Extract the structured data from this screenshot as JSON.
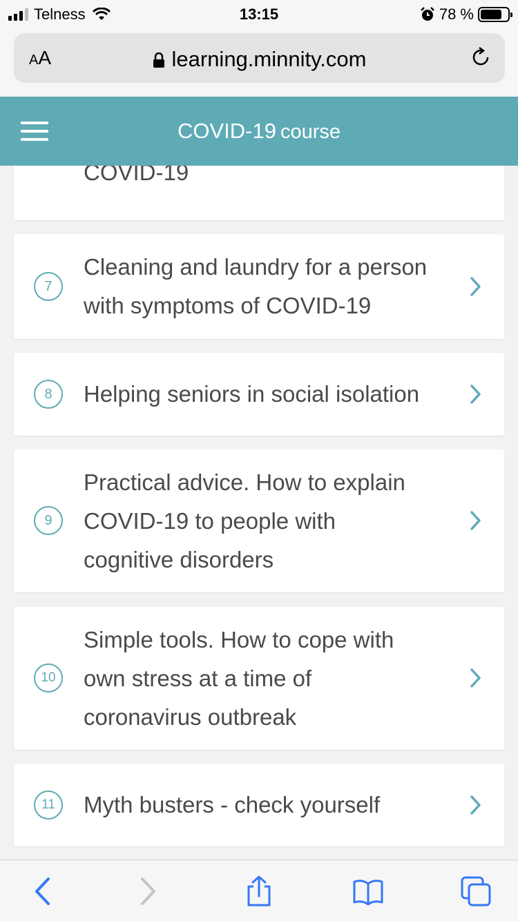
{
  "status_bar": {
    "carrier": "Telness",
    "time": "13:15",
    "battery": "78 %",
    "battery_level": 0.78
  },
  "browser": {
    "text_size_label_small": "A",
    "text_size_label_large": "A",
    "url": "learning.minnity.com"
  },
  "header": {
    "title_main": "COVID-19",
    "title_sub": "course"
  },
  "partial_card": {
    "text": "COVID-19"
  },
  "lessons": [
    {
      "number": "7",
      "title_lines": [
        "Cleaning and laundry for a person",
        "with symptoms of COVID-19"
      ]
    },
    {
      "number": "8",
      "title_lines": [
        "Helping seniors in social isolation"
      ]
    },
    {
      "number": "9",
      "title_lines": [
        "Practical advice. How to explain",
        "COVID-19 to people with",
        "cognitive disorders"
      ]
    },
    {
      "number": "10",
      "title_lines": [
        "Simple tools. How to cope with",
        "own stress at a time of",
        "coronavirus outbreak"
      ]
    },
    {
      "number": "11",
      "title_lines": [
        "Myth busters - check yourself"
      ]
    }
  ],
  "colors": {
    "accent": "#5eabb6",
    "ios_blue": "#3478f6",
    "ios_disabled": "#c4c4c6"
  },
  "icons": {
    "back": "chevron-left-icon",
    "forward": "chevron-right-icon",
    "share": "share-icon",
    "bookmarks": "book-icon",
    "tabs": "tabs-icon"
  }
}
